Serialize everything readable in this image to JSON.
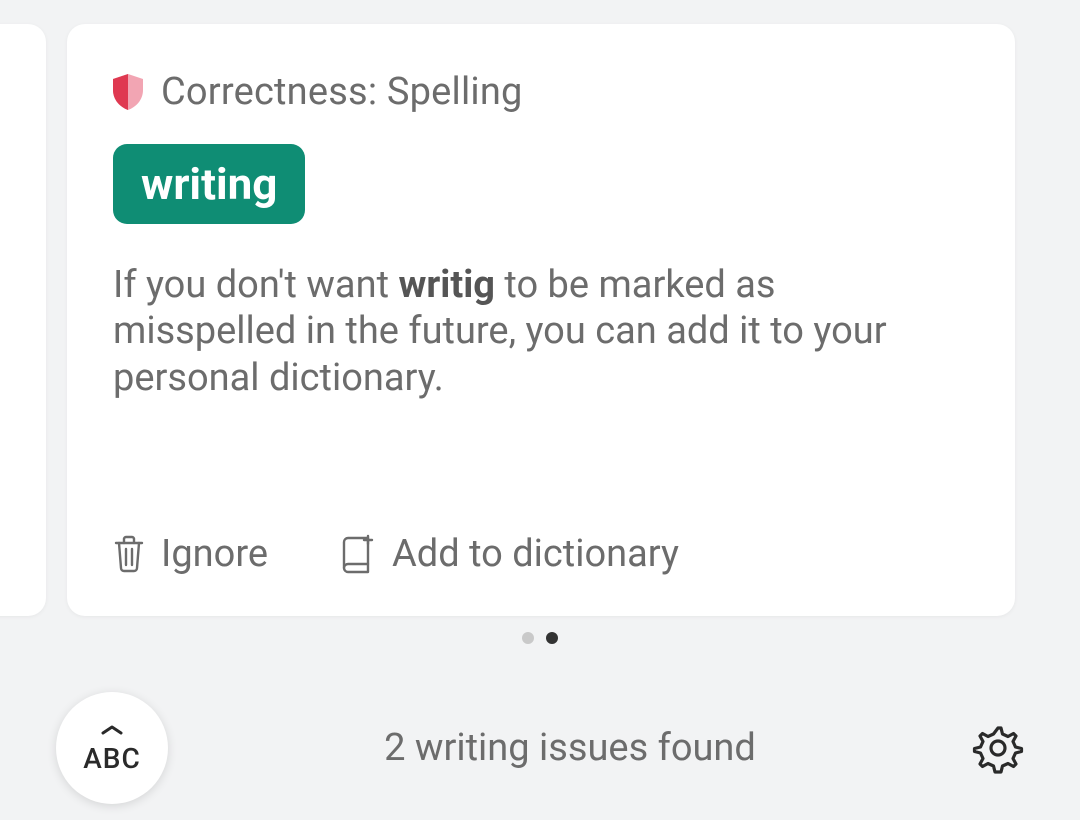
{
  "card": {
    "category": "Correctness: Spelling",
    "suggestion": "writing",
    "explanation_pre": "If you don't want ",
    "explanation_bold": "writig",
    "explanation_post": " to be marked as misspelled in the future, you can add it to your personal dictionary.",
    "ignore_label": "Ignore",
    "add_label": "Add to dictionary"
  },
  "pager": {
    "count": 2,
    "active": 1
  },
  "bottom": {
    "keyboard_label": "ABC",
    "status": "2 writing issues found"
  }
}
